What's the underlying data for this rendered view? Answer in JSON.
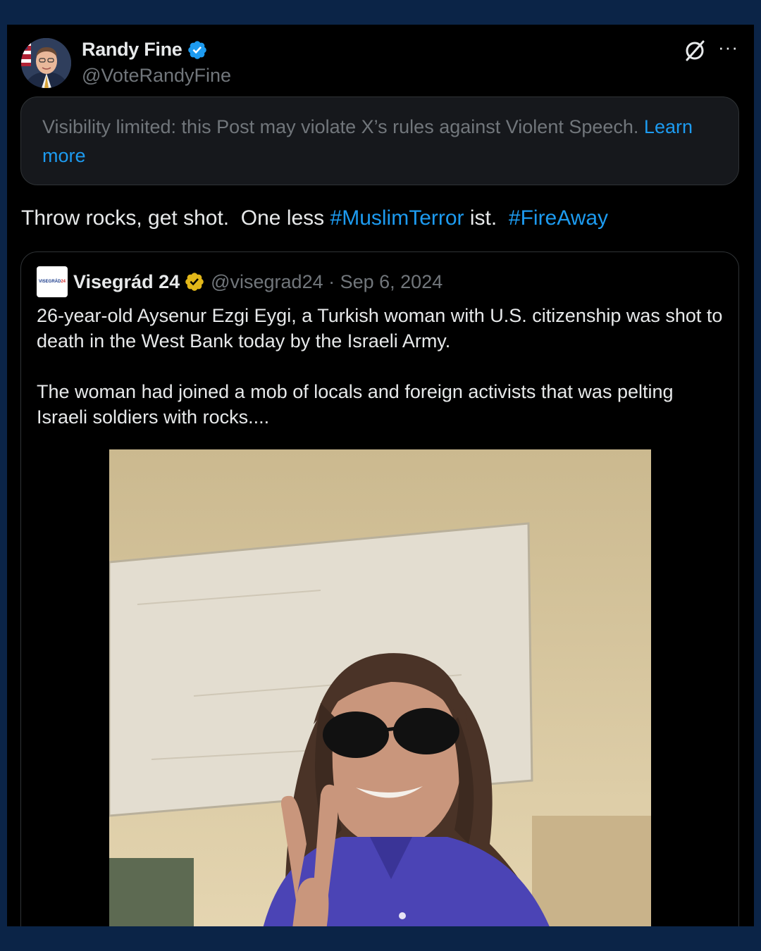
{
  "post": {
    "author_name": "Randy Fine",
    "author_handle": "@VoteRandyFine",
    "verified_icon": "verified-badge-icon",
    "grok_icon": "grok-slash-icon",
    "more_label": "···"
  },
  "notice": {
    "text": "Visibility limited: this Post may violate X’s rules against Violent Speech. ",
    "link": "Learn more"
  },
  "tweet": {
    "t1": "Throw rocks, get shot.  One less ",
    "tag1": "#MuslimTerror",
    "t2": " ist.  ",
    "tag2": "#FireAway"
  },
  "quote": {
    "logo_text_a": "VISEGRÁD",
    "logo_text_b": "24",
    "name": "Visegrád 24",
    "handle_date": "@visegrad24 · Sep 6, 2024",
    "para1": "26-year-old Aysenur Ezgi Eygi, a Turkish woman with U.S. citizenship was shot to death in the West Bank today by the Israeli Army.",
    "para2": "The woman had joined a mob of locals and foreign activists that was pelting Israeli soldiers with rocks...."
  },
  "colors": {
    "link": "#1d9bf0",
    "text": "#e7e9ea",
    "muted": "#71767b",
    "gold_badge": "#e2b719"
  }
}
